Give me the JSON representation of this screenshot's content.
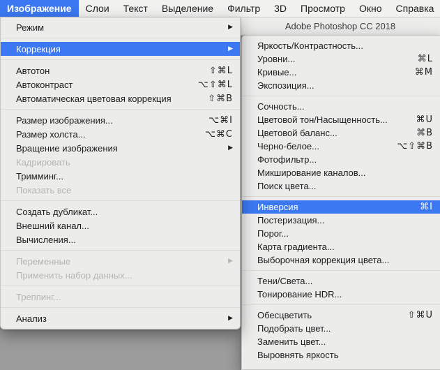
{
  "colors": {
    "highlight": "#3b78f2",
    "menu_bg": "#ececeb",
    "app_bg": "#9c9c9c",
    "disabled_text": "#b5b5b4"
  },
  "window_title": "Adobe Photoshop CC 2018",
  "menu_bar": {
    "selected_index": 0,
    "items": [
      {
        "label": "Изображение"
      },
      {
        "label": "Слои"
      },
      {
        "label": "Текст"
      },
      {
        "label": "Выделение"
      },
      {
        "label": "Фильтр"
      },
      {
        "label": "3D"
      },
      {
        "label": "Просмотр"
      },
      {
        "label": "Окно"
      },
      {
        "label": "Справка"
      }
    ]
  },
  "image_menu": {
    "name": "image-menu",
    "sections": [
      [
        {
          "label": "Режим",
          "submenu": true
        }
      ],
      [
        {
          "label": "Коррекция",
          "submenu": true,
          "selected": true
        }
      ],
      [
        {
          "label": "Автотон",
          "shortcut": "⇧⌘L"
        },
        {
          "label": "Автоконтраст",
          "shortcut": "⌥⇧⌘L"
        },
        {
          "label": "Автоматическая цветовая коррекция",
          "shortcut": "⇧⌘B"
        }
      ],
      [
        {
          "label": "Размер изображения...",
          "shortcut": "⌥⌘I"
        },
        {
          "label": "Размер холста...",
          "shortcut": "⌥⌘C"
        },
        {
          "label": "Вращение изображения",
          "submenu": true
        },
        {
          "label": "Кадрировать",
          "disabled": true
        },
        {
          "label": "Тримминг..."
        },
        {
          "label": "Показать все",
          "disabled": true
        }
      ],
      [
        {
          "label": "Создать дубликат..."
        },
        {
          "label": "Внешний канал..."
        },
        {
          "label": "Вычисления..."
        }
      ],
      [
        {
          "label": "Переменные",
          "submenu": true,
          "disabled": true
        },
        {
          "label": "Применить набор данных...",
          "disabled": true
        }
      ],
      [
        {
          "label": "Треппинг...",
          "disabled": true
        }
      ],
      [
        {
          "label": "Анализ",
          "submenu": true
        }
      ]
    ]
  },
  "adjustments_menu": {
    "name": "adjustments-menu",
    "sections": [
      [
        {
          "label": "Яркость/Контрастность..."
        },
        {
          "label": "Уровни...",
          "shortcut": "⌘L"
        },
        {
          "label": "Кривые...",
          "shortcut": "⌘M"
        },
        {
          "label": "Экспозиция..."
        }
      ],
      [
        {
          "label": "Сочность..."
        },
        {
          "label": "Цветовой тон/Насыщенность...",
          "shortcut": "⌘U"
        },
        {
          "label": "Цветовой баланс...",
          "shortcut": "⌘B"
        },
        {
          "label": "Черно-белое...",
          "shortcut": "⌥⇧⌘B"
        },
        {
          "label": "Фотофильтр..."
        },
        {
          "label": "Микширование каналов..."
        },
        {
          "label": "Поиск цвета..."
        }
      ],
      [
        {
          "label": "Инверсия",
          "shortcut": "⌘I",
          "selected": true
        },
        {
          "label": "Постеризация..."
        },
        {
          "label": "Порог..."
        },
        {
          "label": "Карта градиента..."
        },
        {
          "label": "Выборочная коррекция цвета..."
        }
      ],
      [
        {
          "label": "Тени/Света..."
        },
        {
          "label": "Тонирование HDR..."
        }
      ],
      [
        {
          "label": "Обесцветить",
          "shortcut": "⇧⌘U"
        },
        {
          "label": "Подобрать цвет..."
        },
        {
          "label": "Заменить цвет..."
        },
        {
          "label": "Выровнять яркость"
        }
      ]
    ]
  }
}
